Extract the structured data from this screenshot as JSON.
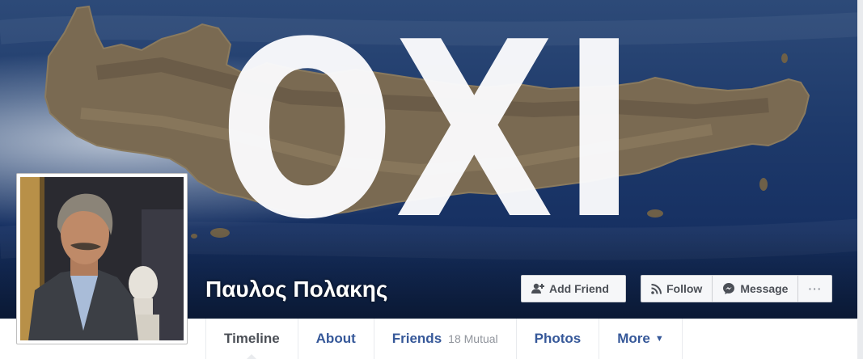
{
  "cover": {
    "overlay_text": "OXI",
    "colors": {
      "sea": "#1e3a6b",
      "land": "#7a6a52",
      "overlay_text": "#fafafc"
    }
  },
  "profile": {
    "name": "Παυλος Πολακης"
  },
  "actions": {
    "add_friend": "Add Friend",
    "follow": "Follow",
    "message": "Message",
    "more": "···"
  },
  "nav": {
    "tabs": [
      {
        "label": "Timeline",
        "sub": "",
        "icon": ""
      },
      {
        "label": "About",
        "sub": "",
        "icon": ""
      },
      {
        "label": "Friends",
        "sub": "18 Mutual",
        "icon": ""
      },
      {
        "label": "Photos",
        "sub": "",
        "icon": ""
      },
      {
        "label": "More",
        "sub": "",
        "icon": "caret-down-icon"
      }
    ],
    "active": "Timeline",
    "colors": {
      "link": "#365899",
      "active": "#4b4f56",
      "muted": "#90949c"
    }
  }
}
